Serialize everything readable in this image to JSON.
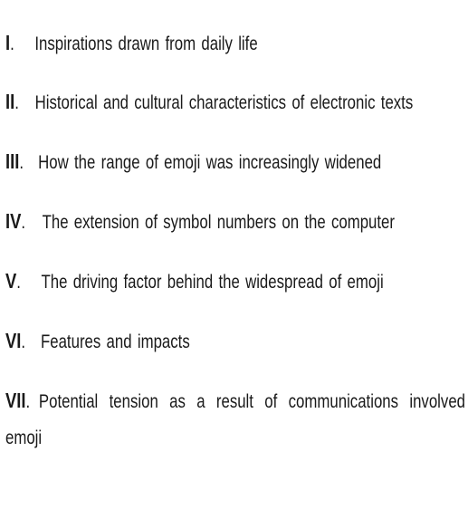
{
  "items": [
    {
      "numeral": "I",
      "text": "Inspirations drawn from daily life"
    },
    {
      "numeral": "II",
      "text": "Historical and cultural characteristics of electronic texts"
    },
    {
      "numeral": "III",
      "text": "How the range of emoji was increasingly widened"
    },
    {
      "numeral": "IV",
      "text": "The extension of symbol numbers on the computer"
    },
    {
      "numeral": "V",
      "text": "The driving factor behind the widespread of emoji"
    },
    {
      "numeral": "VI",
      "text": "Features and impacts"
    },
    {
      "numeral": "VII",
      "text": "Potential tension as a result of communications involved emoji"
    }
  ]
}
